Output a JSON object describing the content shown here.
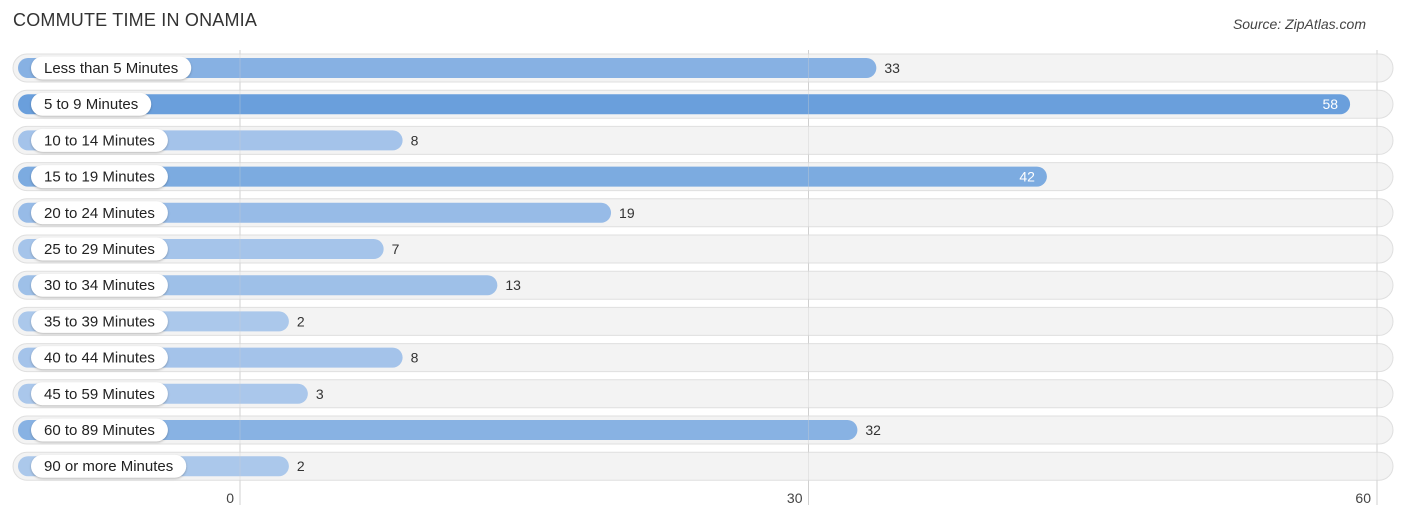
{
  "header": {
    "title": "COMMUTE TIME IN ONAMIA",
    "source": "Source: ZipAtlas.com"
  },
  "chart_data": {
    "type": "bar",
    "orientation": "horizontal",
    "title": "COMMUTE TIME IN ONAMIA",
    "xlabel": "",
    "ylabel": "",
    "categories": [
      "Less than 5 Minutes",
      "5 to 9 Minutes",
      "10 to 14 Minutes",
      "15 to 19 Minutes",
      "20 to 24 Minutes",
      "25 to 29 Minutes",
      "30 to 34 Minutes",
      "35 to 39 Minutes",
      "40 to 44 Minutes",
      "45 to 59 Minutes",
      "60 to 89 Minutes",
      "90 or more Minutes"
    ],
    "values": [
      33,
      58,
      8,
      42,
      19,
      7,
      13,
      2,
      8,
      3,
      32,
      2
    ],
    "xlim": [
      0,
      60
    ],
    "xticks": [
      0,
      30,
      60
    ],
    "grid": true,
    "colors": {
      "bar_strong": "#6a9fdc",
      "bar_light": "#adc9ec",
      "track": "#f2f2f2",
      "track_border": "#dddddd",
      "gridline": "#d0d0d0",
      "value_inside": "#ffffff",
      "value_outside": "#333333"
    }
  }
}
